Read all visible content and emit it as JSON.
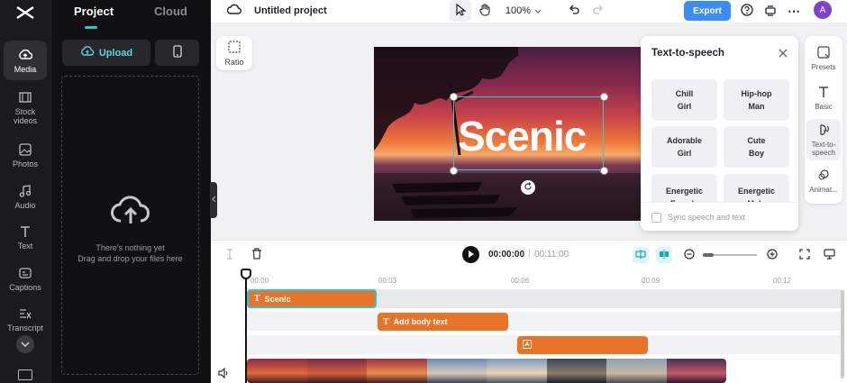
{
  "rail": {
    "items": [
      {
        "label": "Media",
        "icon": "media-icon"
      },
      {
        "label": "Stock\nvideos",
        "icon": "film-icon"
      },
      {
        "label": "Photos",
        "icon": "image-icon"
      },
      {
        "label": "Audio",
        "icon": "music-icon"
      },
      {
        "label": "Text",
        "icon": "text-icon"
      },
      {
        "label": "Captions",
        "icon": "captions-icon"
      },
      {
        "label": "Transcript",
        "icon": "transcript-icon"
      }
    ]
  },
  "panel": {
    "tabs": [
      "Project",
      "Cloud"
    ],
    "upload_label": "Upload",
    "empty_line1": "There's nothing yet",
    "empty_line2": "Drag and drop your files here"
  },
  "topbar": {
    "title": "Untitled project",
    "zoom": "100%",
    "export_label": "Export",
    "avatar_initial": "A"
  },
  "canvas": {
    "ratio_label": "Ratio",
    "overlay_text": "Scenic"
  },
  "tts": {
    "title": "Text-to-speech",
    "voices": [
      {
        "line1": "Chill",
        "line2": "Girl"
      },
      {
        "line1": "Hip-hop",
        "line2": "Man"
      },
      {
        "line1": "Adorable",
        "line2": "Girl"
      },
      {
        "line1": "Cute",
        "line2": "Boy"
      },
      {
        "line1": "Energetic",
        "line2": "Female"
      },
      {
        "line1": "Energetic",
        "line2": "Male"
      }
    ],
    "sync_label": "Sync speech and text"
  },
  "right_rail": {
    "items": [
      {
        "label": "Presets"
      },
      {
        "label": "Basic"
      },
      {
        "label": "Text-to-\nspeech"
      },
      {
        "label": "Animat..."
      }
    ]
  },
  "timeline": {
    "current_time": "00:00:00",
    "separator": "|",
    "duration": "00:11:00",
    "ticks": [
      "00:00",
      "00:03",
      "00:06",
      "00:09",
      "00:12"
    ],
    "clips": [
      {
        "label": "Scenic"
      },
      {
        "label": "Add body text"
      },
      {
        "label": ""
      }
    ]
  },
  "colors": {
    "accent": "#31c3cf",
    "clip": "#e8742a",
    "export": "#3c8cf6"
  }
}
